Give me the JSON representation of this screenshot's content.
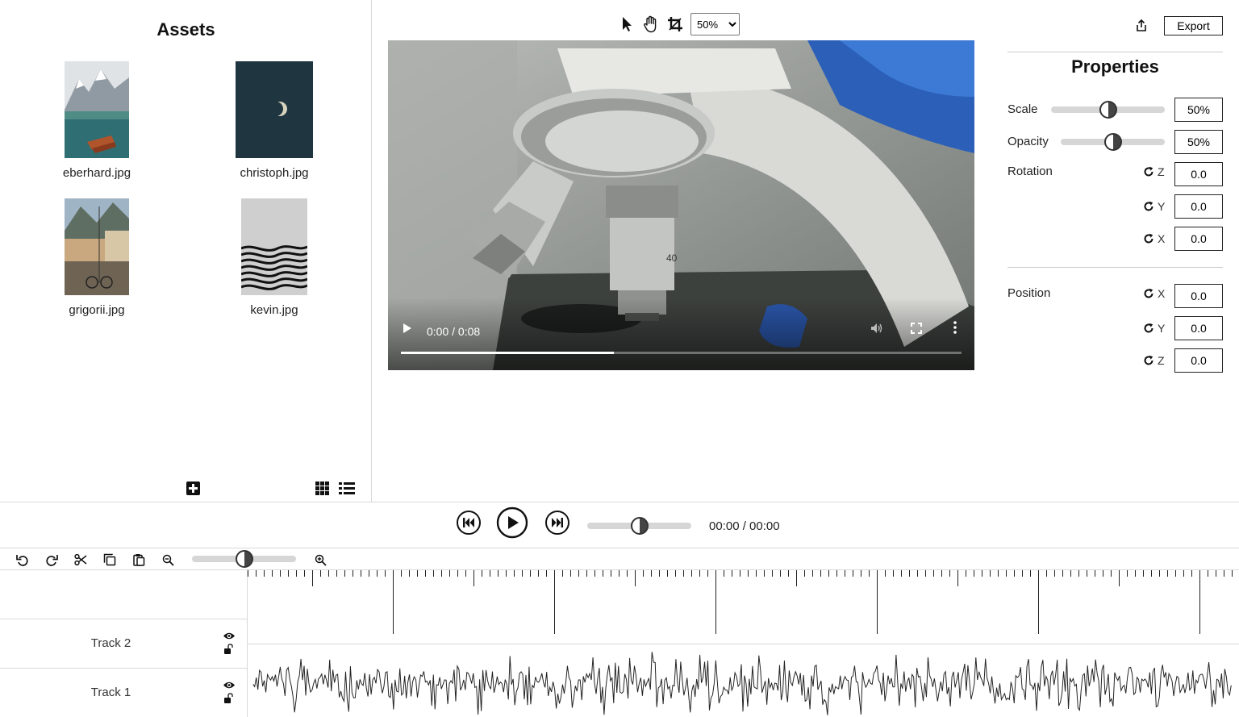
{
  "assets": {
    "title": "Assets",
    "items": [
      {
        "name": "eberhard.jpg"
      },
      {
        "name": "christoph.jpg"
      },
      {
        "name": "grigorii.jpg"
      },
      {
        "name": "kevin.jpg"
      }
    ],
    "footer_icons": [
      "add-icon",
      "grid-view-icon",
      "list-view-icon"
    ]
  },
  "preview": {
    "tools": [
      "pointer-icon",
      "hand-icon",
      "crop-icon"
    ],
    "zoom": "50%",
    "zoom_options": [
      "50%"
    ],
    "video": {
      "time": "0:00 / 0:08",
      "progress": 0.38
    }
  },
  "properties": {
    "export_label": "Export",
    "title": "Properties",
    "scale_label": "Scale",
    "scale_value": "50%",
    "opacity_label": "Opacity",
    "opacity_value": "50%",
    "rotation_label": "Rotation",
    "rotation": [
      {
        "axis": "Z",
        "value": "0.0"
      },
      {
        "axis": "Y",
        "value": "0.0"
      },
      {
        "axis": "X",
        "value": "0.0"
      }
    ],
    "position_label": "Position",
    "position": [
      {
        "axis": "X",
        "value": "0.0"
      },
      {
        "axis": "Y",
        "value": "0.0"
      },
      {
        "axis": "Z",
        "value": "0.0"
      }
    ]
  },
  "transport": {
    "time": "00:00 / 00:00",
    "scrubber": 0.5
  },
  "timeline": {
    "zoom": 0.5,
    "tracks": [
      {
        "name": "Track 2"
      },
      {
        "name": "Track 1"
      }
    ]
  }
}
